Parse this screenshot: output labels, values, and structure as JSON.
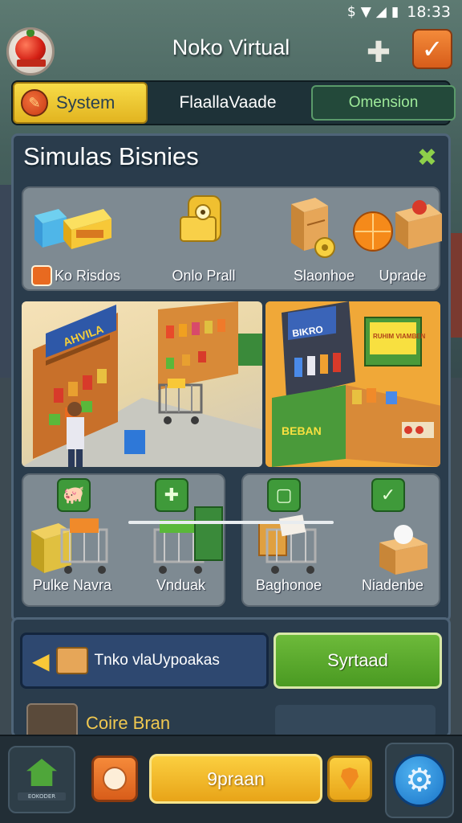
{
  "status_bar": {
    "time": "18:33",
    "icons": [
      "dollar-icon",
      "wifi-icon",
      "signal-icon",
      "battery-icon"
    ]
  },
  "header": {
    "title": "Noko Virtual",
    "logo_text": ""
  },
  "tabs": [
    {
      "label": "System",
      "active": true
    },
    {
      "label": "FlaallaVaade",
      "active": false
    },
    {
      "label": "Omension",
      "active": false
    }
  ],
  "panel": {
    "title": "Simulas Bisnies",
    "items": [
      {
        "label": "Ko Risdos",
        "icon": "boxes-icon"
      },
      {
        "label": "Onlo Prall",
        "icon": "padlock-icon"
      },
      {
        "label": "Slaonhoe",
        "icon": "cabinet-icon"
      },
      {
        "label": "Uprade",
        "icon": "orange-crate-icon"
      }
    ],
    "scenes": [
      {
        "sign_text": "AHVILA"
      },
      {
        "sign_text": "BIKRO",
        "board_text": "RUHIM VIAMBEN",
        "counter_text": "BEBAN"
      }
    ],
    "cards_left": [
      {
        "label": "Pulke Navra",
        "badge": "pig-icon"
      },
      {
        "label": "Vnduak",
        "badge": "puzzle-icon"
      }
    ],
    "cards_right": [
      {
        "label": "Baghonoe",
        "badge": "square-icon"
      },
      {
        "label": "Niadenbe",
        "badge": "check-icon"
      }
    ]
  },
  "actions": {
    "shop_label": "Tnko vlaUypoakas",
    "start_label": "Syrtaad",
    "core_label": "Coire Bran"
  },
  "bottom_nav": {
    "home_sub": "EOKODER",
    "primary_label": "9praan"
  },
  "colors": {
    "accent_green": "#4a9a22",
    "accent_yellow": "#e8a418",
    "accent_orange": "#d85d1a",
    "panel_bg": "#2a3c4c"
  }
}
